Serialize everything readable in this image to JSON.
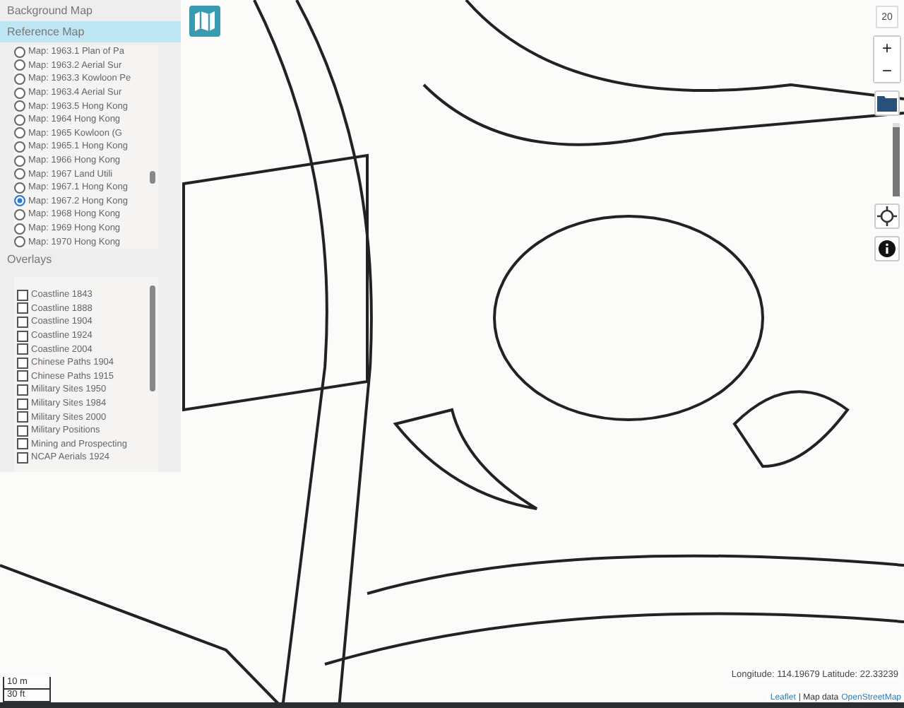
{
  "panel": {
    "sections": [
      {
        "title": "Background Map",
        "selected": false
      },
      {
        "title": "Reference Map",
        "selected": true
      }
    ],
    "reference_maps": [
      {
        "label": "Map: 1963.1 Plan of Pa",
        "selected": false
      },
      {
        "label": "Map: 1963.2 Aerial Sur",
        "selected": false
      },
      {
        "label": "Map: 1963.3 Kowloon Pe",
        "selected": false
      },
      {
        "label": "Map: 1963.4 Aerial Sur",
        "selected": false
      },
      {
        "label": "Map: 1963.5 Hong Kong",
        "selected": false
      },
      {
        "label": "Map: 1964 Hong Kong",
        "selected": false
      },
      {
        "label": "Map: 1965 Kowloon (G",
        "selected": false
      },
      {
        "label": "Map: 1965.1 Hong Kong",
        "selected": false
      },
      {
        "label": "Map: 1966 Hong Kong",
        "selected": false
      },
      {
        "label": "Map: 1967 Land Utili",
        "selected": false
      },
      {
        "label": "Map: 1967.1 Hong Kong",
        "selected": false
      },
      {
        "label": "Map: 1967.2 Hong Kong",
        "selected": true
      },
      {
        "label": "Map: 1968 Hong Kong",
        "selected": false
      },
      {
        "label": "Map: 1969 Hong Kong",
        "selected": false
      },
      {
        "label": "Map: 1970 Hong Kong",
        "selected": false
      }
    ],
    "overlays_title": "Overlays",
    "overlays": [
      {
        "label": "Coastline 1843",
        "checked": false
      },
      {
        "label": "Coastline 1888",
        "checked": false
      },
      {
        "label": "Coastline 1904",
        "checked": false
      },
      {
        "label": "Coastline 1924",
        "checked": false
      },
      {
        "label": "Coastline 2004",
        "checked": false
      },
      {
        "label": "Chinese Paths 1904",
        "checked": false
      },
      {
        "label": "Chinese Paths 1915",
        "checked": false
      },
      {
        "label": "Military Sites 1950",
        "checked": false
      },
      {
        "label": "Military Sites 1984",
        "checked": false
      },
      {
        "label": "Military Sites 2000",
        "checked": false
      },
      {
        "label": "Military Positions",
        "checked": false
      },
      {
        "label": "Mining and Prospecting",
        "checked": false
      },
      {
        "label": "NCAP Aerials 1924",
        "checked": false
      }
    ]
  },
  "controls": {
    "zoom_level": "20",
    "zoom_in": "+",
    "zoom_out": "−",
    "opacity": {
      "level": 0.95
    }
  },
  "scale": {
    "metric": "10 m",
    "imperial": "30 ft"
  },
  "coordinates": "Longitude: 114.19679 Latitude: 22.33239",
  "attribution": {
    "leaflet": "Leaflet",
    "text": "| Map data",
    "link": "OpenStreetMap"
  }
}
